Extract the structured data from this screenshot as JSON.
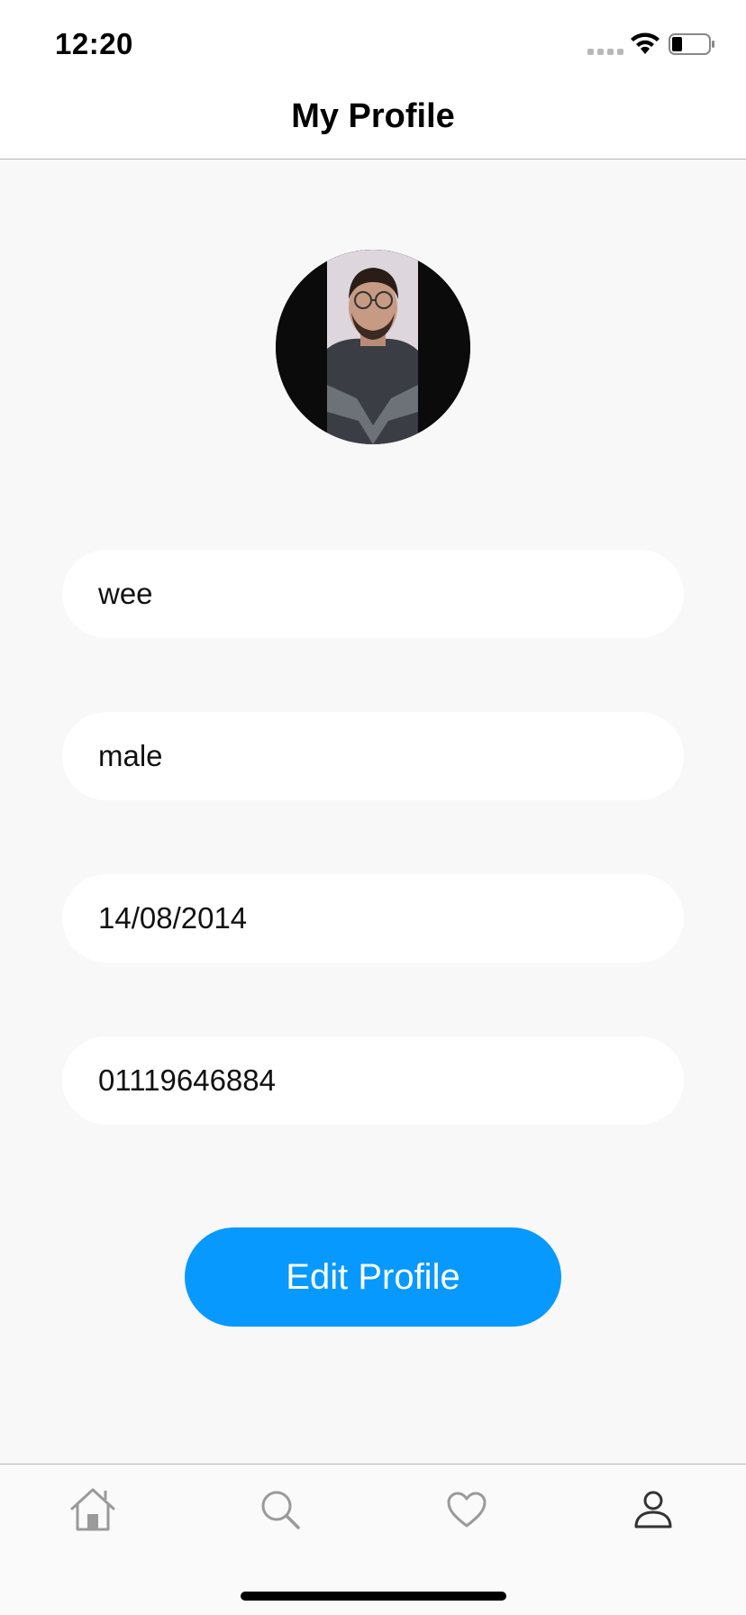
{
  "status_bar": {
    "time": "12:20"
  },
  "header": {
    "title": "My Profile"
  },
  "profile": {
    "name": "wee",
    "gender": "male",
    "birth_date": "14/08/2014",
    "phone": "01119646884"
  },
  "actions": {
    "edit_label": "Edit Profile"
  },
  "tab_bar": {
    "items": [
      {
        "icon": "home-icon"
      },
      {
        "icon": "search-icon"
      },
      {
        "icon": "heart-icon"
      },
      {
        "icon": "profile-icon",
        "active": true
      }
    ]
  },
  "colors": {
    "accent": "#0799fd",
    "background": "#f8f8f8",
    "field_background": "#ffffff",
    "tab_inactive": "#9a9a9a",
    "tab_active": "#333333"
  }
}
